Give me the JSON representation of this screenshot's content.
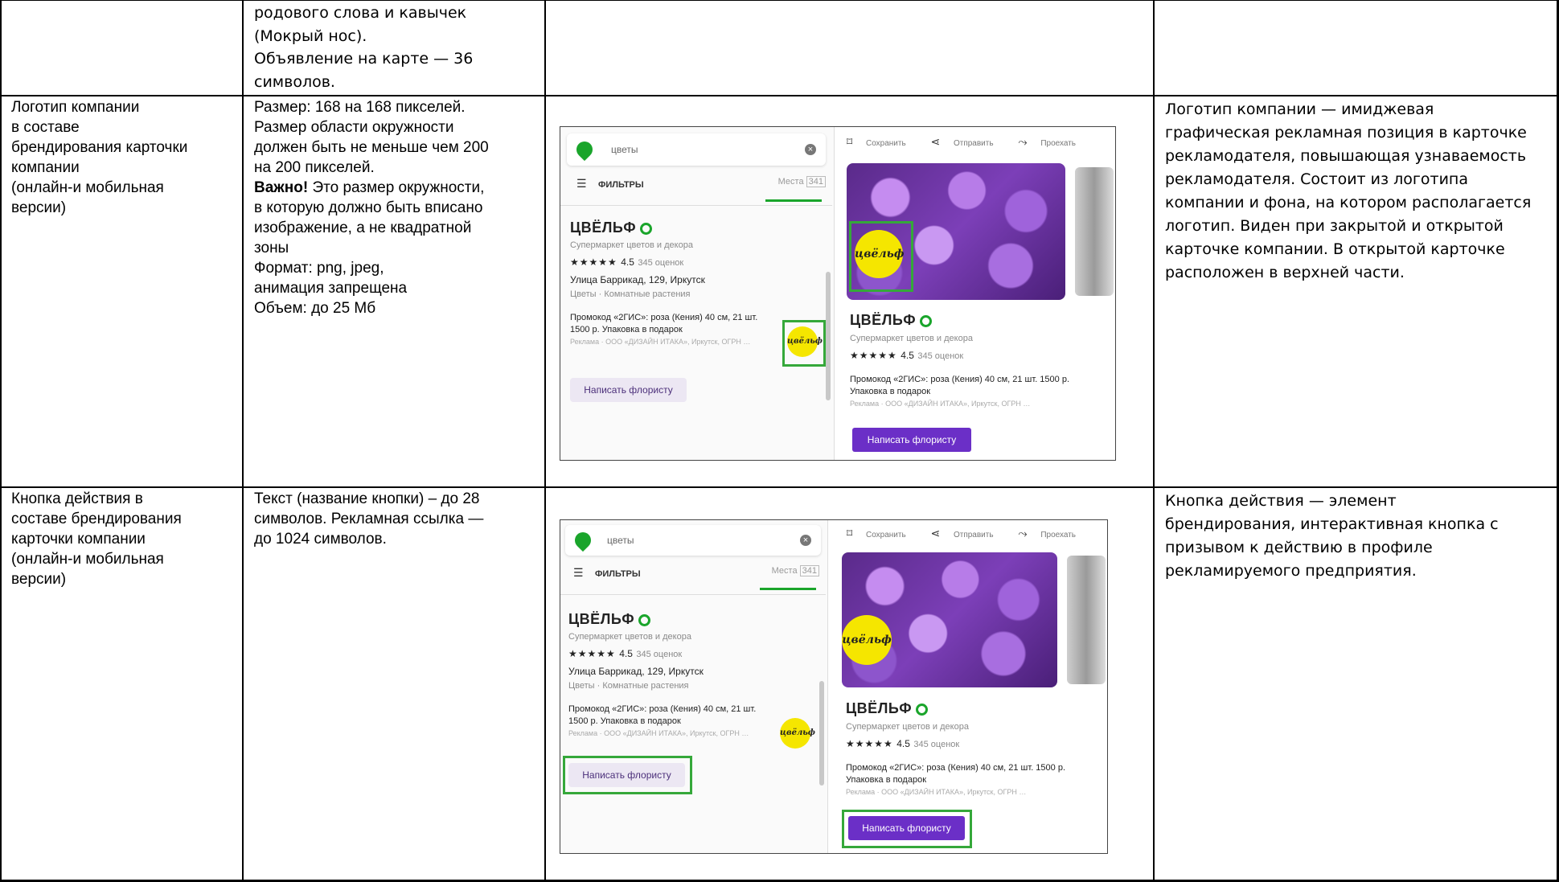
{
  "row1": {
    "col2_lines": [
      "родового слова и кавычек",
      "(Мокрый нос).",
      "Объявление на карте — 36",
      "символов."
    ]
  },
  "row2": {
    "title_lines": [
      "Логотип компании",
      "в составе",
      "брендирования карточки",
      "компании",
      "(онлайн-и мобильная",
      "версии)"
    ],
    "req_lines": [
      "Размер: 168 на 168 пикселей.",
      "Размер области окружности",
      "должен быть не меньше чем 200",
      "на 200 пикселей."
    ],
    "important_label": "Важно!",
    "important_text": " Это размер окружности,",
    "req_lines2": [
      "в которую должно быть вписано",
      "изображение, а не квадратной",
      "зоны",
      "Формат: png, jpeg,",
      "анимация запрещена",
      "Объем: до 25 Мб"
    ],
    "desc_lines": [
      "Логотип компании — имиджевая",
      "графическая рекламная позиция в карточке",
      "рекламодателя, повышающая  узнаваемость",
      "рекламодателя. Состоит из логотипа",
      "компании и фона, на котором располагается",
      "логотип. Виден при закрытой и открытой",
      "карточке компании. В открытой карточке",
      "расположен в верхней части."
    ]
  },
  "row3": {
    "title_lines": [
      "Кнопка действия в",
      "составе брендирования",
      "карточки компании",
      "(онлайн-и мобильная",
      "версии)"
    ],
    "req_lines": [
      "Текст (название кнопки) – до 28",
      "символов. Рекламная ссылка —",
      "до 1024 символов."
    ],
    "desc_lines": [
      "Кнопка действия — элемент",
      "брендирования, интерактивная кнопка с",
      "призывом к действию в профиле",
      "рекламируемого предприятия."
    ]
  },
  "screenshot": {
    "search_text": "цветы",
    "filters": "ФИЛЬТРЫ",
    "places": "Места",
    "places_count": "341",
    "company": "ЦВЁЛЬФ",
    "category": "Супермаркет цветов и декора",
    "rating_stars": "★★★★★",
    "rating": "4.5",
    "reviews": "345 оценок",
    "address": "Улица Баррикад, 129, Иркутск",
    "rubrics": "Цветы · Комнатные растения",
    "promo_left": "Промокод «2ГИС»: роза (Кения) 40 см, 21 шт. 1500 р. Упаковка в подарок",
    "promo_right": "Промокод «2ГИС»: роза (Кения) 40 см, 21 шт. 1500 р. Упаковка в подарок",
    "ad_line": "Реклама · ООО «ДИЗАЙН ИТАКА», Иркутск, ОГРН …",
    "button": "Написать флористу",
    "save": "Сохранить",
    "send": "Отправить",
    "route": "Проехать",
    "logo_text": "цвёльф",
    "highlight_color": "#35a83a",
    "button_color": "#6b2fc7"
  }
}
